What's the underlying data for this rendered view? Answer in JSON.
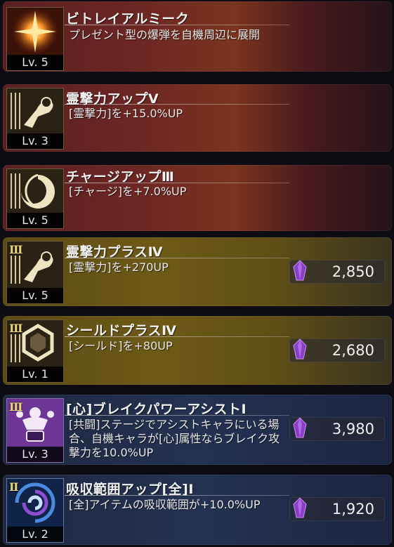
{
  "items": [
    {
      "title": "ビトレイアルミーク",
      "desc": "プレゼント型の爆弾を自機周辺に展開",
      "level": "Lv. 5",
      "rank": "",
      "price": "",
      "icon": "starburst-icon",
      "theme": "red"
    },
    {
      "title": "霊撃力アップⅤ",
      "desc": "[霊撃力]を+15.0%UP",
      "level": "Lv. 3",
      "rank": "",
      "price": "",
      "icon": "spirit-power-icon",
      "theme": "red"
    },
    {
      "title": "チャージアップⅢ",
      "desc": "[チャージ]を+7.0%UP",
      "level": "Lv. 5",
      "rank": "",
      "price": "",
      "icon": "charge-swirl-icon",
      "theme": "red"
    },
    {
      "title": "霊撃力プラスⅣ",
      "desc": "[霊撃力]を+270UP",
      "level": "Lv. 5",
      "rank": "Ⅲ",
      "price": "2,850",
      "icon": "spirit-power-icon",
      "theme": "gold"
    },
    {
      "title": "シールドプラスⅣ",
      "desc": "[シールド]を+80UP",
      "level": "Lv. 1",
      "rank": "Ⅲ",
      "price": "2,680",
      "icon": "shield-hexagon-icon",
      "theme": "gold"
    },
    {
      "title": "[心]ブレイクパワーアシストⅠ",
      "desc": "[共闘]ステージでアシストキャラにいる場合、自機キャラが[心]属性ならブレイク攻撃力を10.0%UP",
      "level": "Lv. 3",
      "rank": "Ⅲ",
      "price": "3,980",
      "icon": "assist-heart-icon",
      "theme": "navy"
    },
    {
      "title": "吸収範囲アップ[全]Ⅰ",
      "desc": "[全]アイテムの吸収範囲が+10.0%UP",
      "level": "Lv. 2",
      "rank": "Ⅱ",
      "price": "1,920",
      "icon": "vortex-icon",
      "theme": "navy"
    }
  ],
  "colors": {
    "gem": "#8b3fc9",
    "rank": "#e9d67a"
  }
}
